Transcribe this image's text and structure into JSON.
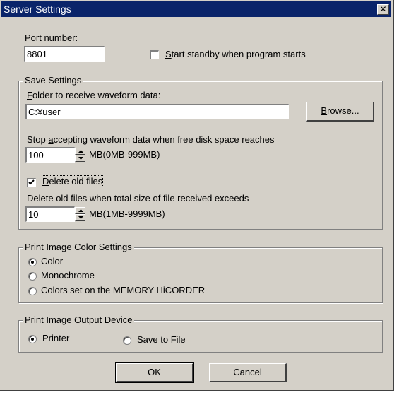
{
  "window": {
    "title": "Server Settings",
    "close_glyph": "✕"
  },
  "port": {
    "label": "Port number:",
    "value": "8801"
  },
  "standby": {
    "label": "Start standby when program starts",
    "checked": false
  },
  "save": {
    "legend": "Save Settings",
    "folder_label": "Folder to receive waveform data:",
    "folder_value": "C:¥user",
    "browse_label": "Browse...",
    "stop_label": "Stop accepting waveform data when free disk space reaches",
    "stop_value": "100",
    "stop_range": "MB(0MB-999MB)",
    "delete_label": "Delete old files",
    "delete_checked": true,
    "exceed_label": "Delete old files when total size of file received exceeds",
    "exceed_value": "10",
    "exceed_range": "MB(1MB-9999MB)"
  },
  "color": {
    "legend": "Print Image Color Settings",
    "options": [
      "Color",
      "Monochrome",
      "Colors set on the MEMORY HiCORDER"
    ],
    "selected": "Color"
  },
  "output": {
    "legend": "Print Image Output Device",
    "options": [
      "Printer",
      "Save to File"
    ],
    "selected": "Printer"
  },
  "buttons": {
    "ok": "OK",
    "cancel": "Cancel"
  }
}
